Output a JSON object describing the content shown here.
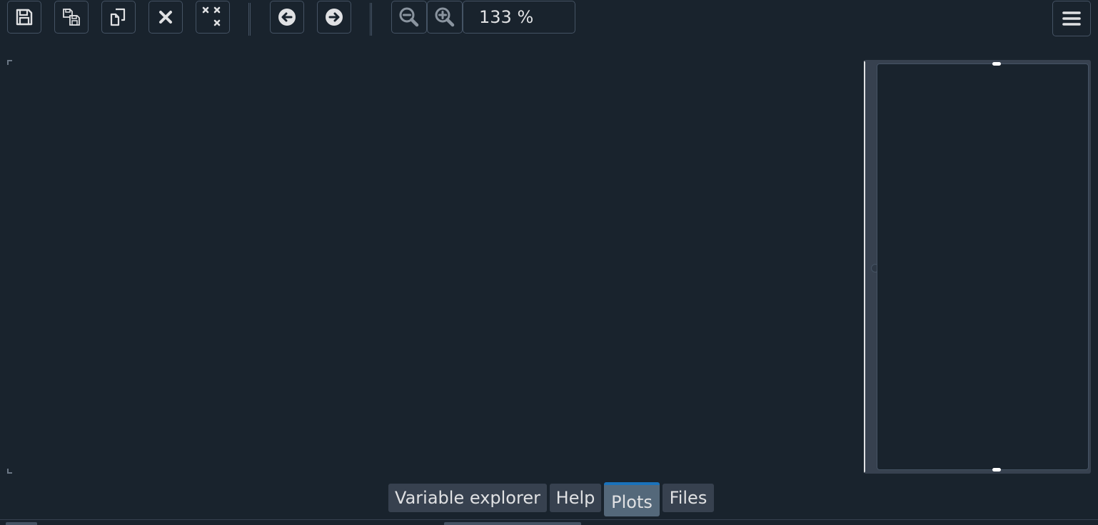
{
  "toolbar": {
    "buttons": [
      {
        "name": "save-plot",
        "icon": "floppy-disk-icon"
      },
      {
        "name": "save-all-plots",
        "icon": "multiple-floppy-icon"
      },
      {
        "name": "copy-plot",
        "icon": "copy-icon"
      },
      {
        "name": "remove-plot",
        "icon": "close-x-icon"
      },
      {
        "name": "remove-all-plots",
        "icon": "multiple-x-icon"
      },
      {
        "name": "previous-plot",
        "icon": "arrow-left-circle-icon"
      },
      {
        "name": "next-plot",
        "icon": "arrow-right-circle-icon"
      },
      {
        "name": "zoom-out",
        "icon": "zoom-out-icon"
      },
      {
        "name": "zoom-in",
        "icon": "zoom-in-icon"
      },
      {
        "name": "options-menu",
        "icon": "hamburger-menu-icon"
      }
    ],
    "zoom_value": "133 %"
  },
  "tabs": [
    {
      "label": "Variable explorer",
      "active": false
    },
    {
      "label": "Help",
      "active": false
    },
    {
      "label": "Plots",
      "active": true
    },
    {
      "label": "Files",
      "active": false
    }
  ],
  "colors": {
    "background": "#19232d",
    "button_border": "#455364",
    "icon": "#e0e1e3",
    "tab_bg": "#37414f",
    "tab_active_bg": "#54687a",
    "tab_active_accent": "#1a72bb"
  }
}
